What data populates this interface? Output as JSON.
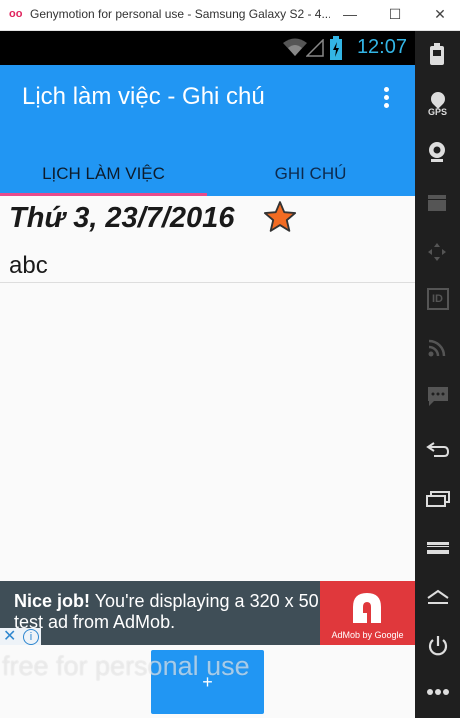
{
  "window": {
    "title": "Genymotion for personal use - Samsung Galaxy S2 - 4....",
    "minimize": "—",
    "maximize": "☐",
    "close": "✕"
  },
  "status_bar": {
    "time": "12:07"
  },
  "app": {
    "title": "Lịch làm việc - Ghi chú",
    "tabs": [
      {
        "label": "LỊCH LÀM VIỆC",
        "selected": true
      },
      {
        "label": "GHI CHÚ",
        "selected": false
      }
    ]
  },
  "list": [
    {
      "date": "Thứ 3, 23/7/2016",
      "note": "abc",
      "starred": true
    }
  ],
  "ad": {
    "headline": "Nice job!",
    "body": " You're displaying a 320 x 50 test ad from AdMob.",
    "brand": "AdMob by Google"
  },
  "fab": {
    "label": "+"
  },
  "watermark": "free for personal use",
  "sidebar": {
    "gps_label": "GPS",
    "buttons": [
      "battery-icon",
      "gps-icon",
      "webcam-icon",
      "clapper-icon",
      "dpad-icon",
      "id-icon",
      "rss-icon",
      "chat-icon",
      "back-icon",
      "recent-apps-icon",
      "menu-icon",
      "home-icon",
      "power-icon",
      "more-icon"
    ]
  },
  "colors": {
    "primary": "#2196f3",
    "indicator": "#e84c8b",
    "star": "#f26b22",
    "ad_bg": "#3f4e57",
    "admob_red": "#e0383c"
  }
}
